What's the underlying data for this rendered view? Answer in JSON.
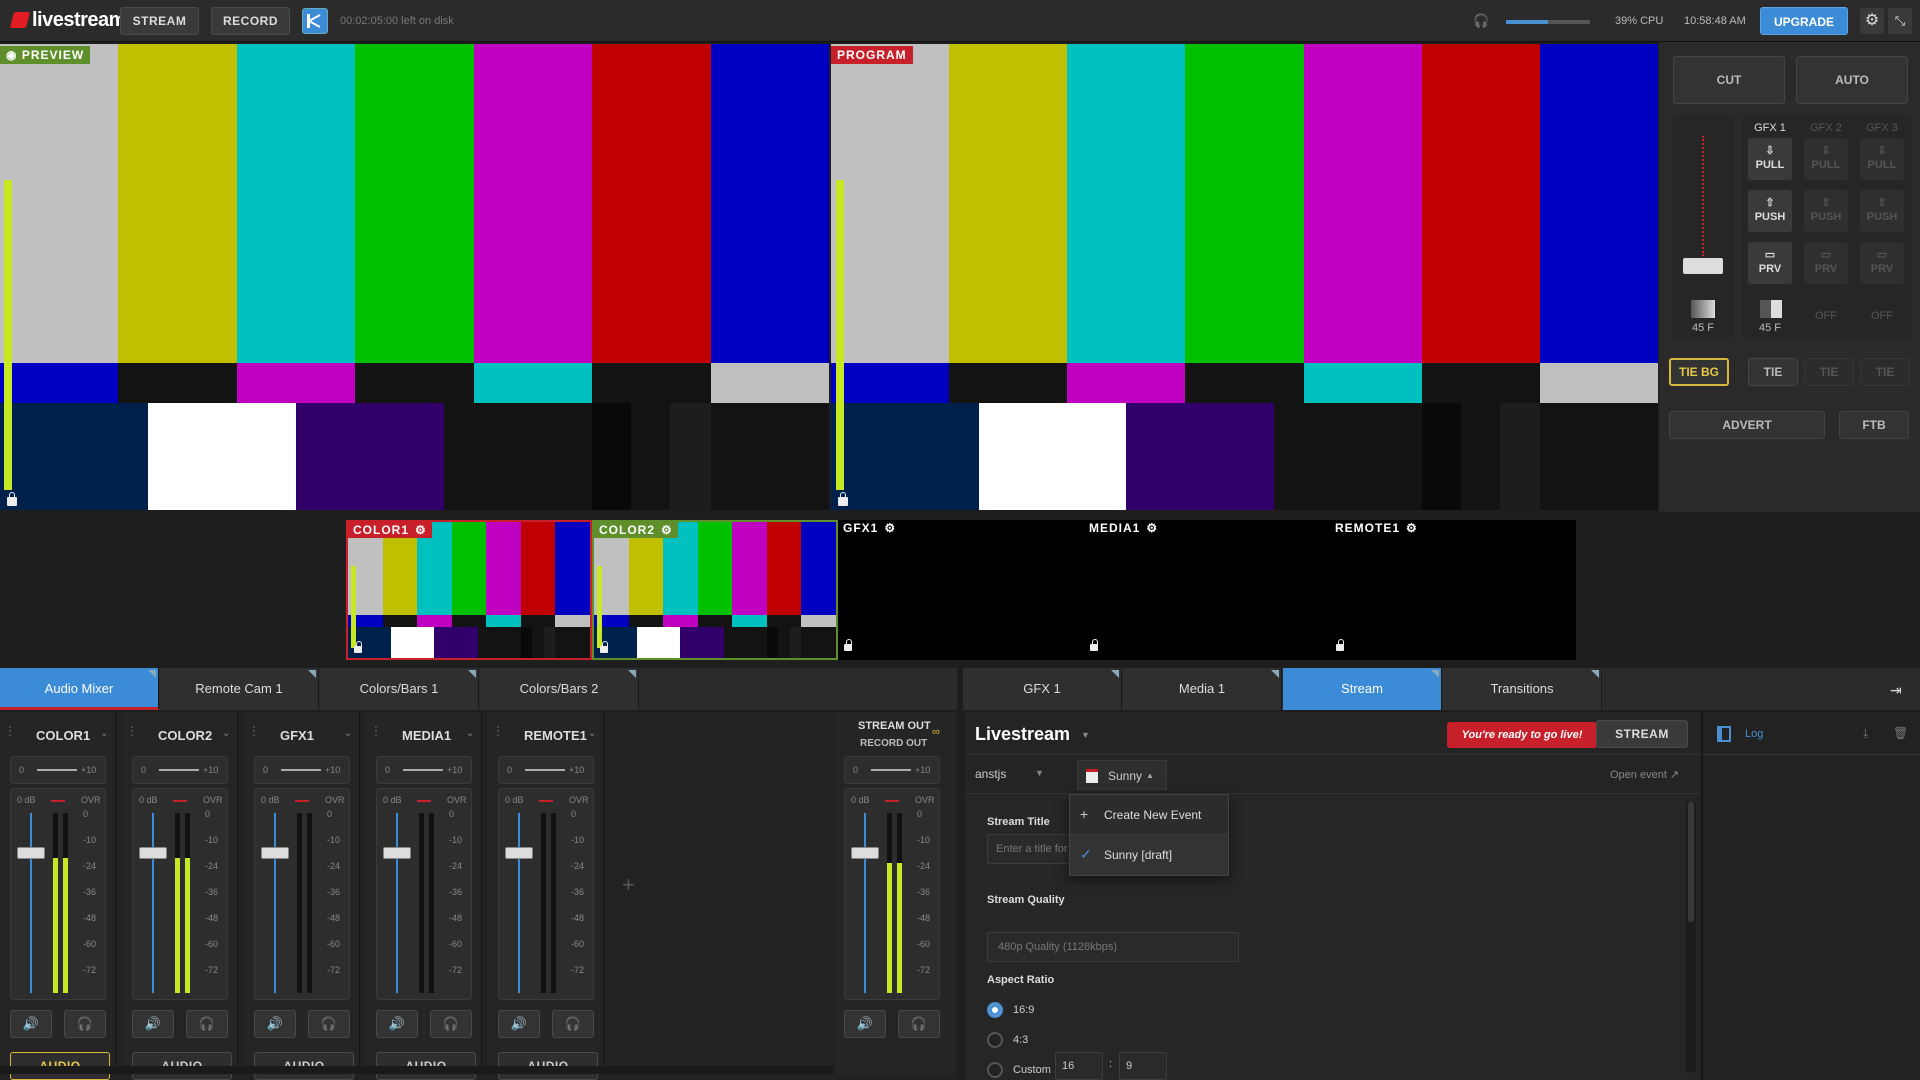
{
  "topbar": {
    "brand": "livestream",
    "stream_btn": "STREAM",
    "record_btn": "RECORD",
    "disk_info": "00:02:05:00 left on disk",
    "volume_level": 0.5,
    "cpu": "39% CPU",
    "clock": "10:58:48 AM",
    "upgrade_btn": "UPGRADE"
  },
  "preview": {
    "label": "PREVIEW"
  },
  "program": {
    "label": "PROGRAM"
  },
  "controls": {
    "cut": "CUT",
    "auto": "AUTO",
    "gfx_cols": [
      {
        "name": "GFX 1",
        "pull": "PULL",
        "push": "PUSH",
        "prv": "PRV",
        "dur": "45 F",
        "tie": "TIE",
        "active": true
      },
      {
        "name": "GFX 2",
        "pull": "PULL",
        "push": "PUSH",
        "prv": "PRV",
        "dur": "OFF",
        "tie": "TIE",
        "active": false
      },
      {
        "name": "GFX 3",
        "pull": "PULL",
        "push": "PUSH",
        "prv": "PRV",
        "dur": "OFF",
        "tie": "TIE",
        "active": false
      }
    ],
    "bg_dur": "45 F",
    "tie_bg": "TIE BG",
    "advert": "ADVERT",
    "ftb": "FTB"
  },
  "sources": [
    {
      "name": "COLOR1",
      "color": "#c8202a"
    },
    {
      "name": "COLOR2",
      "color": "#5f8f2a"
    },
    {
      "name": "GFX1",
      "color": ""
    },
    {
      "name": "MEDIA1",
      "color": ""
    },
    {
      "name": "REMOTE1",
      "color": ""
    }
  ],
  "left_tabs": [
    "Audio Mixer",
    "Remote Cam 1",
    "Colors/Bars 1",
    "Colors/Bars 2"
  ],
  "right_tabs": [
    "GFX 1",
    "Media 1",
    "Stream",
    "Transitions"
  ],
  "audio": {
    "channels": [
      {
        "name": "COLOR1",
        "audio": "AUDIO",
        "level": 0.75,
        "on": true
      },
      {
        "name": "COLOR2",
        "audio": "AUDIO",
        "level": 0.75,
        "on": false
      },
      {
        "name": "GFX1",
        "audio": "AUDIO",
        "level": 0,
        "on": false
      },
      {
        "name": "MEDIA1",
        "audio": "AUDIO",
        "level": 0,
        "on": false
      },
      {
        "name": "REMOTE1",
        "audio": "AUDIO",
        "level": 0,
        "on": false
      }
    ],
    "pan_left": "0",
    "pan_right": "+10",
    "db_label": "0 dB",
    "ovr": "OVR",
    "scale": [
      "0",
      "-10",
      "-24",
      "-36",
      "-48",
      "-60",
      "-72"
    ],
    "stream_out": "STREAM OUT",
    "record_out": "RECORD OUT",
    "add": "+"
  },
  "stream": {
    "provider": "Livestream",
    "ready": "You're ready to go live!",
    "stream_btn": "STREAM",
    "account": "anstjs",
    "event": "Sunny",
    "open_event": "Open event",
    "menu": [
      {
        "label": "Create New Event",
        "icon": "+"
      },
      {
        "label": "Sunny [draft]",
        "icon": "✓"
      }
    ],
    "title_label": "Stream Title",
    "title_placeholder": "Enter a title for",
    "quality_label": "Stream Quality",
    "quality_value": "480p Quality (1128kbps)",
    "aspect_label": "Aspect Ratio",
    "aspects": [
      "16:9",
      "4:3",
      "Custom"
    ],
    "custom_w": "16",
    "custom_sep": ":",
    "custom_h": "9"
  },
  "log": {
    "label": "Log"
  }
}
